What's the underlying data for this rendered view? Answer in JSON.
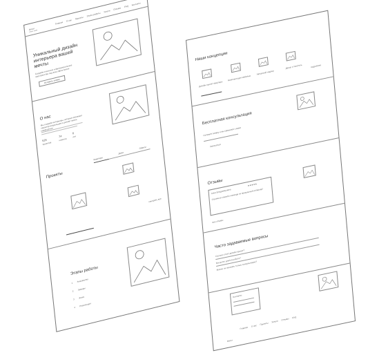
{
  "left_page": {
    "logo": {
      "name": "Decor",
      "tagline": "interior studio"
    },
    "nav": [
      "Главная",
      "О нас",
      "Проекты",
      "Этапы работы",
      "Услуги",
      "Отзывы",
      "FAQ",
      "Контакты"
    ],
    "hero": {
      "title": "Уникальный дизайн интерьера вашей мечты",
      "subtitle": "Создаём стильные и функциональные пространства под ваш образ жизни",
      "button": "Оставить заявку"
    },
    "about": {
      "title": "О нас",
      "text": "Мы создаём интерьеры, которые отражают характер владельцев и делают жизнь комфортнее",
      "stats": [
        {
          "value": "526",
          "label": "проектов"
        },
        {
          "value": "74",
          "label": "клиента"
        },
        {
          "value": "6",
          "label": "лет"
        }
      ]
    },
    "projects": {
      "title": "Проекты",
      "tabs": [
        "Квартиры",
        "Дома",
        "Офисы"
      ],
      "more": "смотреть все"
    },
    "stages": {
      "title": "Этапы работы",
      "steps": [
        {
          "num": "1",
          "name": "Знакомство"
        },
        {
          "num": "2",
          "name": "Замеры"
        },
        {
          "num": "3",
          "name": "Эскиз"
        },
        {
          "num": "4",
          "name": "Реализация"
        }
      ]
    }
  },
  "right_page": {
    "services": {
      "title": "Наши концепции",
      "items": [
        "Дизайн-проект квартиры",
        "Комплектация мебелью",
        "Авторский надзор",
        "Декор и текстиль"
      ],
      "more": "подробнее"
    },
    "consult": {
      "title": "Бесплатная консультация",
      "text": "Оставьте заявку и мы свяжемся с вами",
      "button": "Записаться"
    },
    "reviews": {
      "title": "Отзывы",
      "author": "Анна Владимировна",
      "rating": "★★★★★",
      "text": "Огромное спасибо команде за прекрасный интерьер!",
      "more": "все отзывы"
    },
    "faq": {
      "title": "Часто задаваемые вопросы",
      "questions": [
        "Сколько стоит дизайн-проект?",
        "Как долго длится работа?",
        "Можно ли заказать только консультацию?"
      ]
    },
    "footer": {
      "form_title": "Контакты",
      "nav": [
        "Главная",
        "О нас",
        "Проекты",
        "Услуги",
        "Отзывы",
        "FAQ"
      ],
      "logo": "Decor"
    }
  }
}
